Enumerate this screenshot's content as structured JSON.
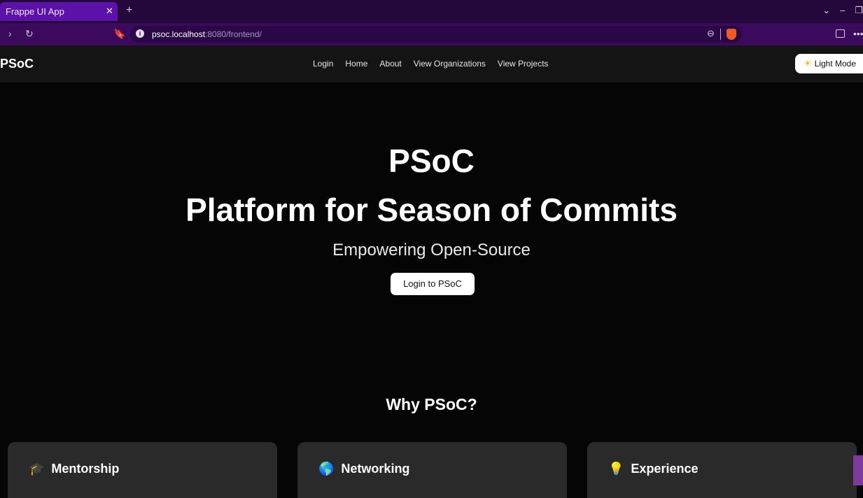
{
  "browser": {
    "tab_title": "Frappe UI App",
    "tab_close": "✕",
    "new_tab": "+",
    "url_host": "psoc.localhost",
    "url_rest": ":8080/frontend/"
  },
  "header": {
    "brand": "PSoC",
    "nav": [
      "Login",
      "Home",
      "About",
      "View Organizations",
      "View Projects"
    ],
    "light_mode": "Light Mode"
  },
  "hero": {
    "title": "PSoC",
    "subtitle": "Platform for Season of Commits",
    "tagline": "Empowering Open-Source",
    "cta": "Login to PSoC"
  },
  "why": {
    "heading": "Why PSoC?",
    "cards": [
      {
        "icon": "🎓",
        "title": "Mentorship"
      },
      {
        "icon": "🌎",
        "title": "Networking"
      },
      {
        "icon": "💡",
        "title": "Experience"
      }
    ]
  }
}
